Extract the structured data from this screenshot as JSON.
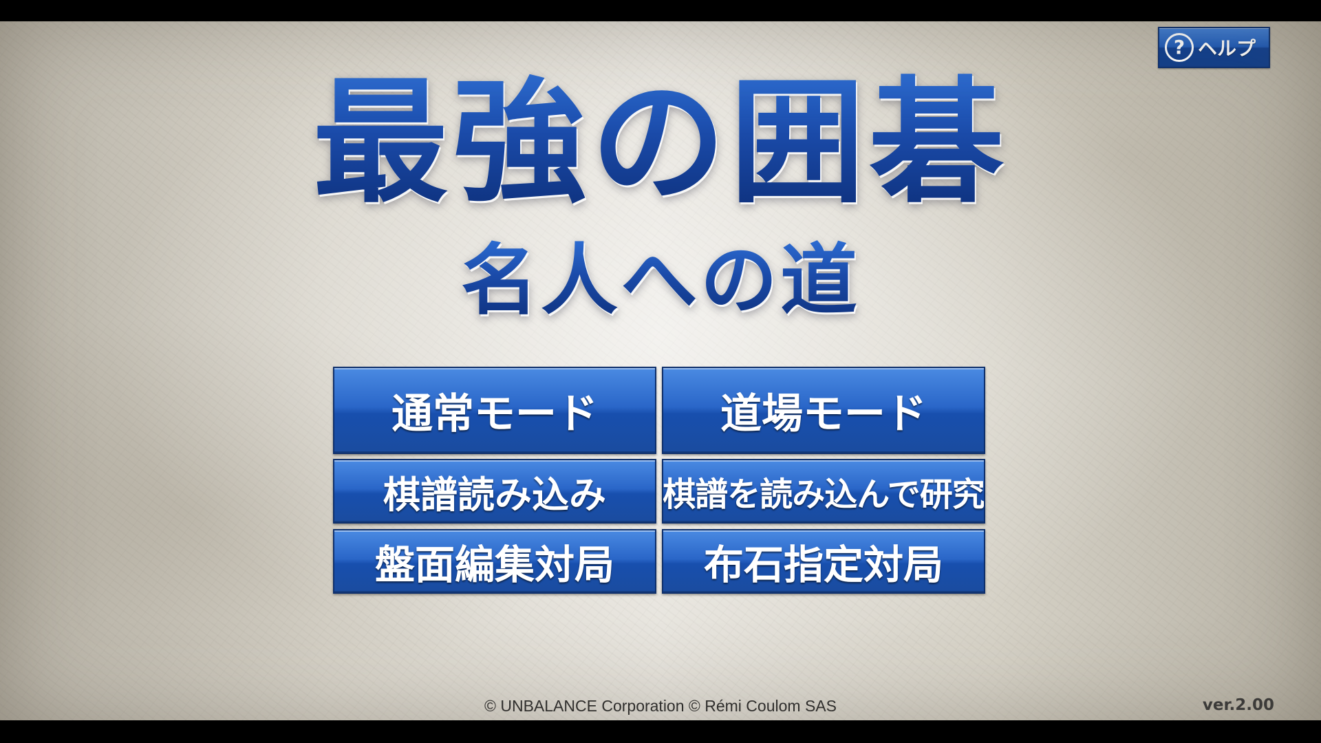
{
  "help": {
    "icon_glyph": "?",
    "icon": "question-circle-icon",
    "label": "ヘルプ"
  },
  "title": {
    "main": "最強の囲碁",
    "subtitle": "名人への道"
  },
  "menu": {
    "normal_mode": "通常モード",
    "dojo_mode": "道場モード",
    "load_kifu": "棋譜読み込み",
    "kifu_study": "棋譜を読み込んで研究",
    "board_edit_game": "盤面編集対局",
    "opening_game": "布石指定対局"
  },
  "footer": {
    "copyright": "© UNBALANCE Corporation  © Rémi Coulom SAS",
    "version": "ver.2.00"
  },
  "colors": {
    "button_blue": "#2a66c8",
    "title_blue": "#1a4aa8",
    "background_paper": "#dcd8ce"
  }
}
